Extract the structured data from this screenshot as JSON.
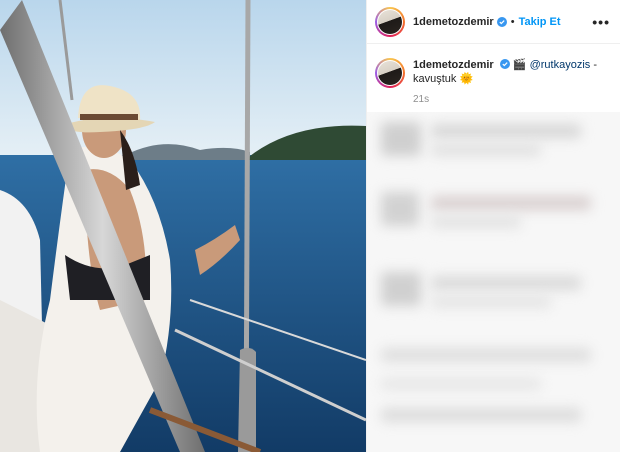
{
  "header": {
    "username": "1demetozdemir",
    "separator": "•",
    "follow_label": "Takip Et",
    "more_label": "•••"
  },
  "caption": {
    "username": "1demetozdemir",
    "emoji": "🎬",
    "mention": "@rutkayozis",
    "dash": " -",
    "text": "kavuştuk",
    "emoji_end": "🌞",
    "time": "21s"
  },
  "colors": {
    "accent": "#0095f6",
    "verified": "#3897f0",
    "mention": "#00376b"
  },
  "icons": [
    "verified-badge-icon",
    "more-options-icon",
    "clapper-icon",
    "sun-icon"
  ]
}
